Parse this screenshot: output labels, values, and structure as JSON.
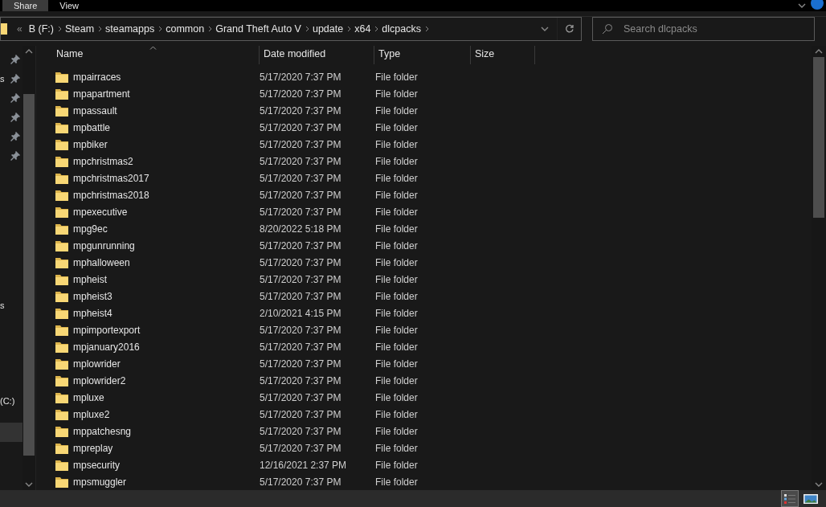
{
  "ribbon": {
    "tabs": [
      {
        "label": "Share",
        "selected": true
      },
      {
        "label": "View",
        "selected": false
      }
    ]
  },
  "address": {
    "overflow": "«",
    "crumbs": [
      "B (F:)",
      "Steam",
      "steamapps",
      "common",
      "Grand Theft Auto V",
      "update",
      "x64",
      "dlcpacks"
    ]
  },
  "search": {
    "placeholder": "Search dlcpacks"
  },
  "sidebar": {
    "items": [
      {
        "pinned": true,
        "selected": false
      },
      {
        "label": "s",
        "pinned": true,
        "selected": false
      },
      {
        "pinned": true,
        "selected": false
      },
      {
        "pinned": true,
        "selected": false
      },
      {
        "pinned": true,
        "selected": false
      },
      {
        "pinned": true,
        "selected": false
      },
      {
        "label": "s",
        "pinned": false,
        "selected": false
      },
      {
        "label": "(C:)",
        "pinned": false,
        "selected": false
      },
      {
        "pinned": false,
        "selected": true
      }
    ]
  },
  "table": {
    "columns": [
      "Name",
      "Date modified",
      "Type",
      "Size"
    ],
    "rows": [
      {
        "name": "mpairraces",
        "date": "5/17/2020 7:37 PM",
        "type": "File folder"
      },
      {
        "name": "mpapartment",
        "date": "5/17/2020 7:37 PM",
        "type": "File folder"
      },
      {
        "name": "mpassault",
        "date": "5/17/2020 7:37 PM",
        "type": "File folder"
      },
      {
        "name": "mpbattle",
        "date": "5/17/2020 7:37 PM",
        "type": "File folder"
      },
      {
        "name": "mpbiker",
        "date": "5/17/2020 7:37 PM",
        "type": "File folder"
      },
      {
        "name": "mpchristmas2",
        "date": "5/17/2020 7:37 PM",
        "type": "File folder"
      },
      {
        "name": "mpchristmas2017",
        "date": "5/17/2020 7:37 PM",
        "type": "File folder"
      },
      {
        "name": "mpchristmas2018",
        "date": "5/17/2020 7:37 PM",
        "type": "File folder"
      },
      {
        "name": "mpexecutive",
        "date": "5/17/2020 7:37 PM",
        "type": "File folder"
      },
      {
        "name": "mpg9ec",
        "date": "8/20/2022 5:18 PM",
        "type": "File folder"
      },
      {
        "name": "mpgunrunning",
        "date": "5/17/2020 7:37 PM",
        "type": "File folder"
      },
      {
        "name": "mphalloween",
        "date": "5/17/2020 7:37 PM",
        "type": "File folder"
      },
      {
        "name": "mpheist",
        "date": "5/17/2020 7:37 PM",
        "type": "File folder"
      },
      {
        "name": "mpheist3",
        "date": "5/17/2020 7:37 PM",
        "type": "File folder"
      },
      {
        "name": "mpheist4",
        "date": "2/10/2021 4:15 PM",
        "type": "File folder"
      },
      {
        "name": "mpimportexport",
        "date": "5/17/2020 7:37 PM",
        "type": "File folder"
      },
      {
        "name": "mpjanuary2016",
        "date": "5/17/2020 7:37 PM",
        "type": "File folder"
      },
      {
        "name": "mplowrider",
        "date": "5/17/2020 7:37 PM",
        "type": "File folder"
      },
      {
        "name": "mplowrider2",
        "date": "5/17/2020 7:37 PM",
        "type": "File folder"
      },
      {
        "name": "mpluxe",
        "date": "5/17/2020 7:37 PM",
        "type": "File folder"
      },
      {
        "name": "mpluxe2",
        "date": "5/17/2020 7:37 PM",
        "type": "File folder"
      },
      {
        "name": "mppatchesng",
        "date": "5/17/2020 7:37 PM",
        "type": "File folder"
      },
      {
        "name": "mpreplay",
        "date": "5/17/2020 7:37 PM",
        "type": "File folder"
      },
      {
        "name": "mpsecurity",
        "date": "12/16/2021 2:37 PM",
        "type": "File folder"
      },
      {
        "name": "mpsmuggler",
        "date": "5/17/2020 7:37 PM",
        "type": "File folder"
      }
    ]
  },
  "status_bar": {
    "views": [
      {
        "kind": "details",
        "selected": true
      },
      {
        "kind": "tiles",
        "selected": false
      }
    ]
  }
}
